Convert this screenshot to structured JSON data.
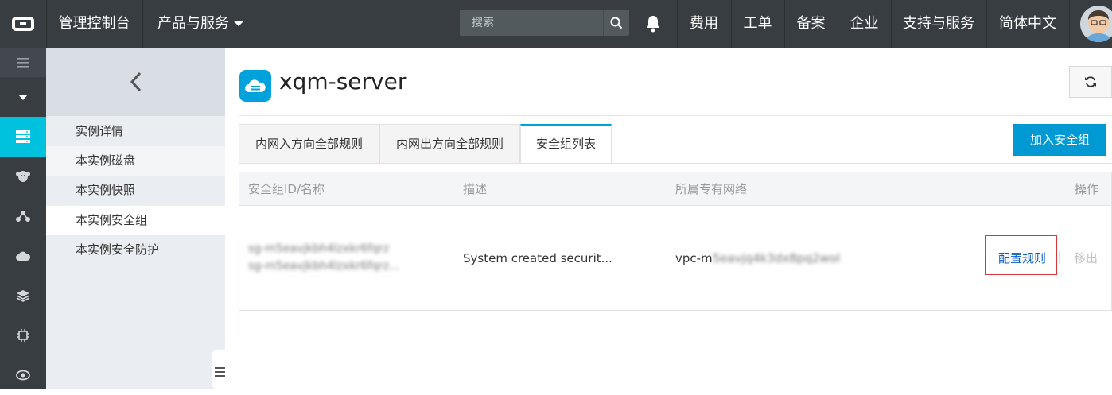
{
  "topbar": {
    "console_label": "管理控制台",
    "products_label": "产品与服务",
    "search_placeholder": "搜索",
    "links": [
      "费用",
      "工单",
      "备案",
      "企业",
      "支持与服务",
      "简体中文"
    ]
  },
  "rail": {
    "icons": [
      "menu-icon",
      "caret-down-icon",
      "server-list-icon",
      "monkey-icon",
      "network-nodes-icon",
      "cloud-icon",
      "layers-icon",
      "chip-icon",
      "eye-icon"
    ]
  },
  "submenu": {
    "items": [
      "实例详情",
      "本实例磁盘",
      "本实例快照",
      "本实例安全组",
      "本实例安全防护"
    ]
  },
  "main": {
    "title": "xqm-server",
    "tabs": [
      "内网入方向全部规则",
      "内网出方向全部规则",
      "安全组列表"
    ],
    "join_button": "加入安全组",
    "table": {
      "headers": [
        "安全组ID/名称",
        "描述",
        "所属专有网络",
        "操作"
      ],
      "row": {
        "id_line1": "sg-m5eavjkbh4lzxkr6fqrz",
        "id_line2": "sg-m5eavjkbh4lzxkr6fqrz...",
        "description": "System created securit...",
        "vpc_prefix": "vpc-m",
        "vpc_rest": "5eavjq4k3dx8pq2wol",
        "action_configure": "配置规则",
        "action_remove": "移出"
      }
    }
  },
  "colors": {
    "topbar": "#373d41",
    "accent": "#00c1de",
    "primary_button": "#0099d4",
    "link": "#0b5dc9"
  }
}
